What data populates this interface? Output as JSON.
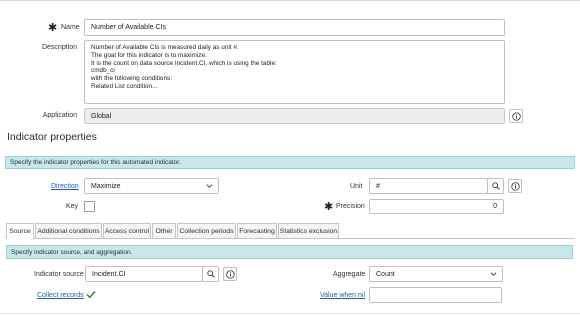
{
  "record": {
    "name_label": "Name",
    "name_value": "Number of Available CIs",
    "description_label": "Description",
    "description_lines": [
      "Number of Available CIs is measured daily as unit #.",
      "The goal for this indicator is to maximize.",
      "It is the count on data source Incident.CI, which is using the table:",
      "cmdb_ci",
      "with the following conditions:",
      "Related List condition..."
    ],
    "application_label": "Application",
    "application_value": "Global"
  },
  "indicator_properties": {
    "heading": "Indicator properties",
    "banner": "Specify the indicator properties for this automated indicator.",
    "direction_label": "Direction",
    "direction_value": "Maximize",
    "unit_label": "Unit",
    "unit_value": "#",
    "key_label": "Key",
    "precision_label": "Precision",
    "precision_value": "0"
  },
  "tabs": [
    {
      "label": "Source",
      "active": true
    },
    {
      "label": "Additional conditions",
      "active": false
    },
    {
      "label": "Access control",
      "active": false
    },
    {
      "label": "Other",
      "active": false
    },
    {
      "label": "Collection periods",
      "active": false
    },
    {
      "label": "Forecasting",
      "active": false
    },
    {
      "label": "Statistics exclusion",
      "active": false
    }
  ],
  "source_tab": {
    "banner": "Specify indicator source, and aggregation.",
    "indicator_source_label": "Indicator source",
    "indicator_source_value": "Incident.CI",
    "aggregate_label": "Aggregate",
    "aggregate_value": "Count",
    "collect_records_label": "Collect records",
    "collect_records_checked": true,
    "value_when_nil_label": "Value when nil",
    "value_when_nil_value": ""
  },
  "icons": {
    "required": "asterisk-icon",
    "info": "info-icon",
    "search": "search-icon",
    "dropdown": "chevron-down-icon",
    "check": "checkmark-icon"
  },
  "colors": {
    "banner_bg": "#c7e7ea",
    "banner_border": "#9cd1d6",
    "link": "#1f5fa7",
    "readonly_bg": "#ededed",
    "checkmark": "#3e7a2f"
  }
}
